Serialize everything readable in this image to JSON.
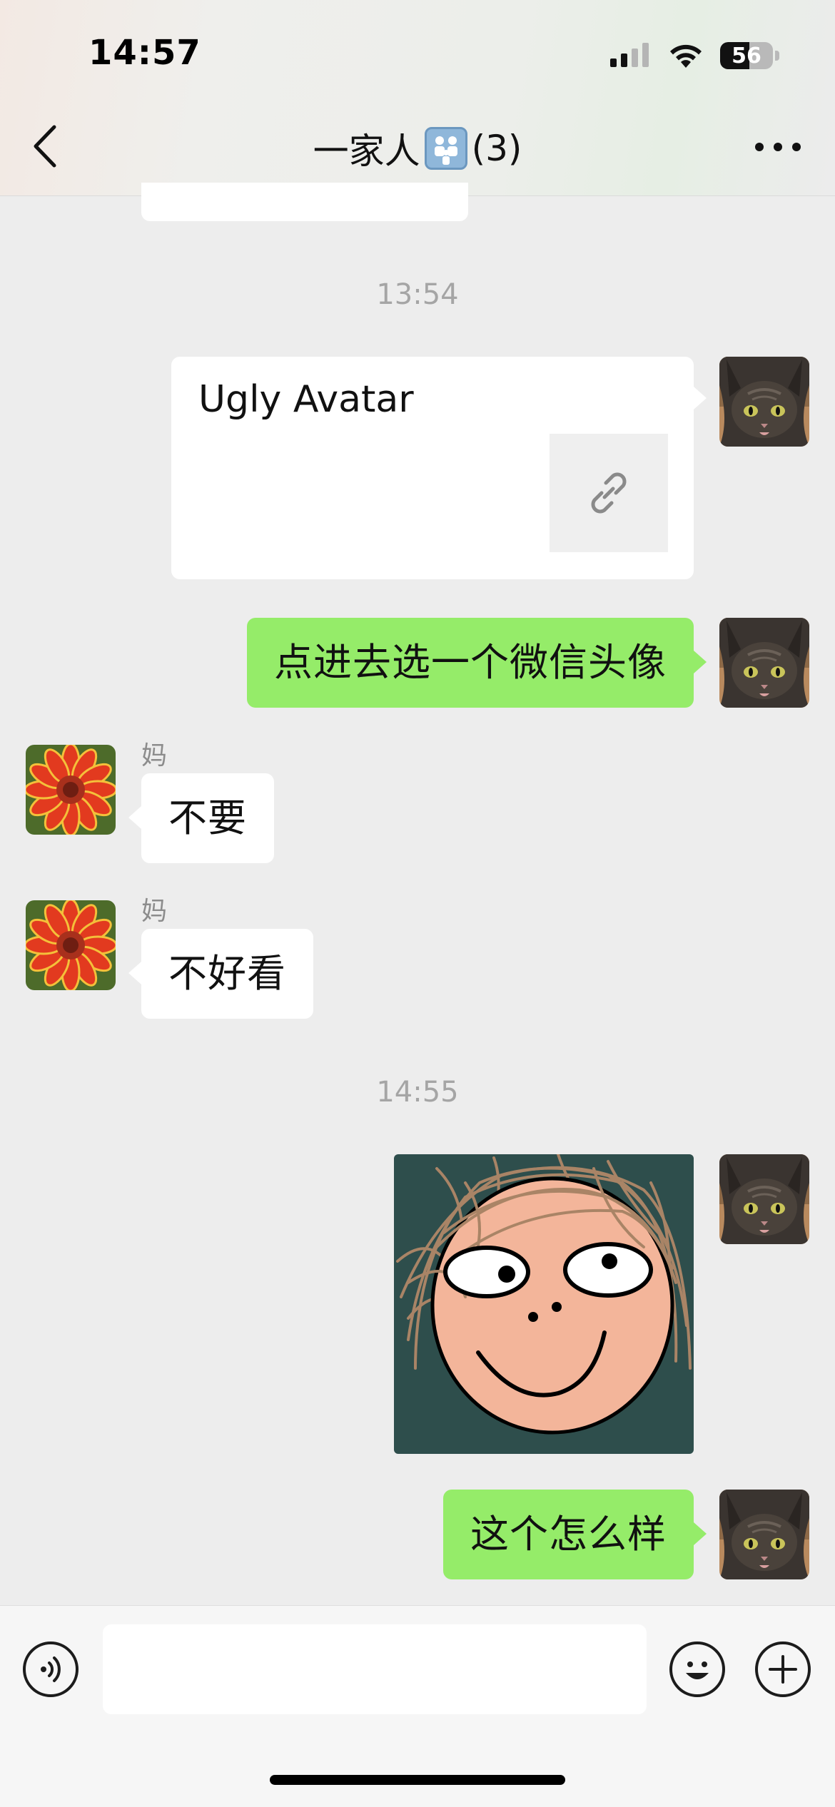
{
  "status_bar": {
    "time": "14:57",
    "battery": "56",
    "battery_fraction": 0.56
  },
  "nav": {
    "title": "一家人",
    "member_count": "(3)"
  },
  "messages": {
    "time_1": "13:54",
    "link_card_title": "Ugly Avatar",
    "msg_green_1": "点进去选一个微信头像",
    "mom_name": "妈",
    "mom_msg_1": "不要",
    "mom_msg_2": "不好看",
    "time_2": "14:55",
    "msg_green_2": "这个怎么样"
  },
  "input_bar": {
    "placeholder": ""
  },
  "icons": {
    "back": "chevron-left-icon",
    "more": "more-dots-icon",
    "voice": "voice-icon",
    "emoji": "emoji-icon",
    "plus": "plus-icon",
    "link": "link-icon",
    "group": "family-group-emoji"
  },
  "colors": {
    "green_bubble": "#95ec69",
    "background": "#ededed",
    "white_bubble": "#ffffff"
  }
}
